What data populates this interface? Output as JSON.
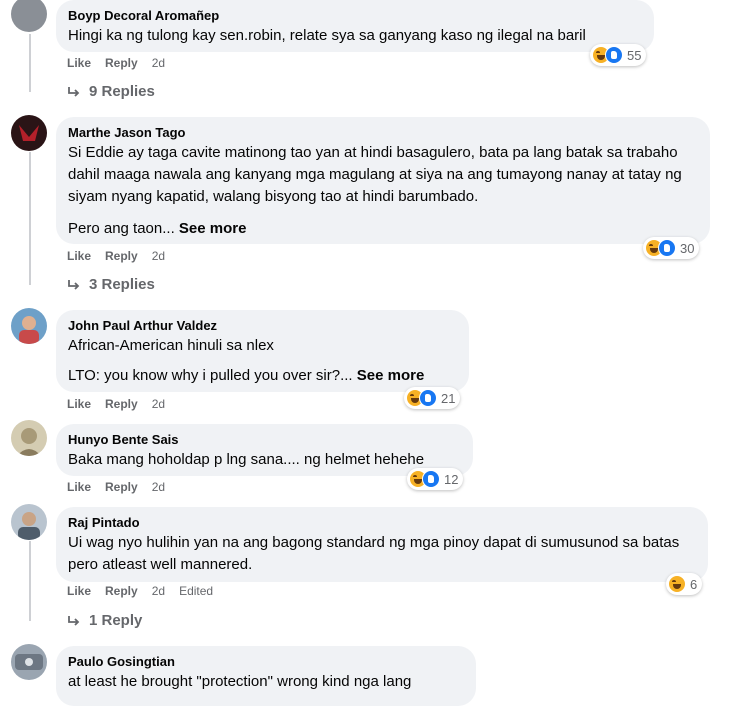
{
  "comments": [
    {
      "author": "Boyp Decoral Aromañep",
      "paragraphs": [
        "Hingi ka ng tulong kay sen.robin, relate sya sa ganyang kaso ng ilegal na baril"
      ],
      "actions": {
        "like": "Like",
        "reply": "Reply",
        "time": "2d"
      },
      "reaction_count": "55",
      "reactions": [
        "haha-icon",
        "like-icon"
      ],
      "replies_label": "9 Replies",
      "avatar_color": "#8a8f96"
    },
    {
      "author": "Marthe Jason Tago",
      "paragraphs": [
        "Si Eddie ay taga cavite matinong tao yan at hindi basagulero, bata pa lang batak sa trabaho dahil maaga nawala ang kanyang mga magulang at siya na ang tumayong nanay at tatay ng siyam nyang kapatid, walang bisyong tao at hindi barumbado."
      ],
      "truncated_text": "Pero ang taon...",
      "see_more": "See more",
      "actions": {
        "like": "Like",
        "reply": "Reply",
        "time": "2d"
      },
      "reaction_count": "30",
      "reactions": [
        "haha-icon",
        "like-icon"
      ],
      "replies_label": "3 Replies",
      "avatar_color": "#2a1416"
    },
    {
      "author": "John Paul Arthur Valdez",
      "paragraphs": [
        "African-American hinuli sa nlex"
      ],
      "truncated_text": "LTO: you know why i pulled you over sir?...",
      "see_more": "See more",
      "actions": {
        "like": "Like",
        "reply": "Reply",
        "time": "2d"
      },
      "reaction_count": "21",
      "reactions": [
        "haha-icon",
        "like-icon"
      ],
      "avatar_color": "#c84a4a"
    },
    {
      "author": "Hunyo Bente Sais",
      "paragraphs": [
        "Baka mang hoholdap p lng sana.... ng helmet hehehe"
      ],
      "actions": {
        "like": "Like",
        "reply": "Reply",
        "time": "2d"
      },
      "reaction_count": "12",
      "reactions": [
        "haha-icon",
        "like-icon"
      ],
      "avatar_color": "#a89a78"
    },
    {
      "author": "Raj Pintado",
      "paragraphs": [
        "Ui wag nyo hulihin yan na ang bagong standard ng mga pinoy dapat di sumusunod sa batas pero atleast well mannered."
      ],
      "actions": {
        "like": "Like",
        "reply": "Reply",
        "time": "2d",
        "edited": "Edited"
      },
      "reaction_count": "6",
      "reactions": [
        "haha-icon"
      ],
      "replies_label": "1 Reply",
      "avatar_color": "#7b8a99"
    },
    {
      "author": "Paulo Gosingtian",
      "paragraphs": [
        "at least he brought \"protection\" wrong kind nga lang"
      ],
      "avatar_color": "#6d7783"
    }
  ]
}
